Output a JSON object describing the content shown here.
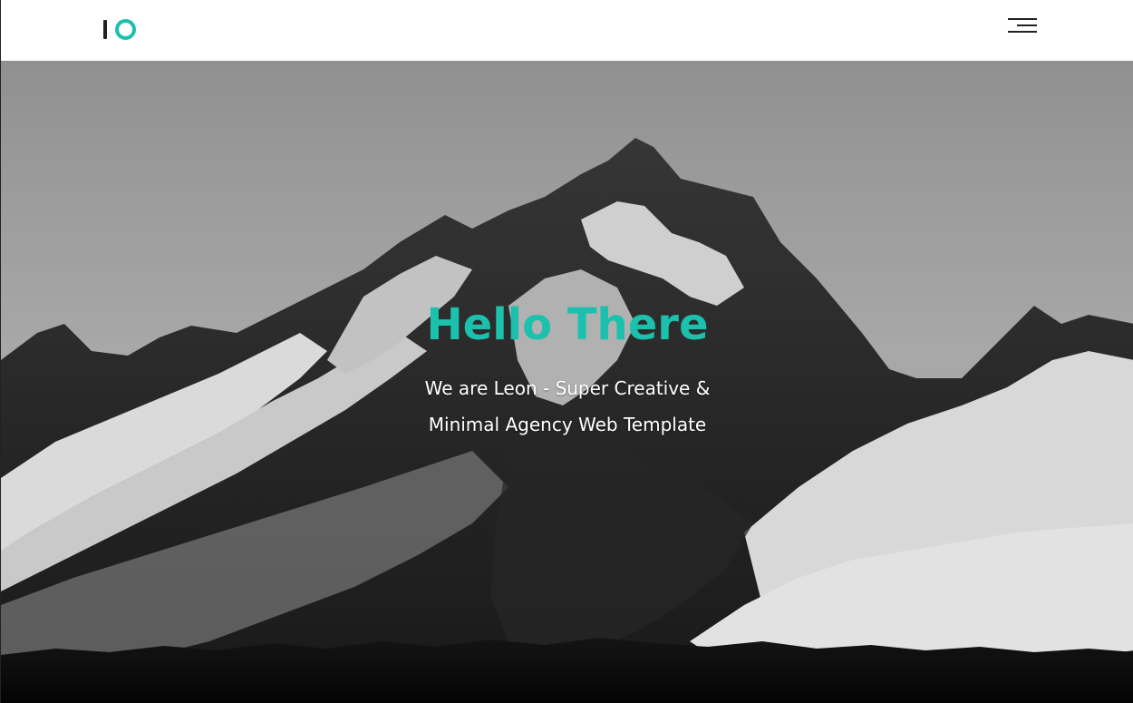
{
  "colors": {
    "accent": "#1bc1ad",
    "logo_bar": "#222222",
    "header_bg": "#ffffff",
    "menu_lines": "#222222"
  },
  "header": {
    "logo_icon": "io-logo",
    "menu_icon": "hamburger-menu-icon"
  },
  "hero": {
    "title": "Hello There",
    "subtitle_line1": "We are Leon - Super Creative &",
    "subtitle_line2": "Minimal Agency Web Template",
    "background_icon": "mountain-landscape-image"
  }
}
